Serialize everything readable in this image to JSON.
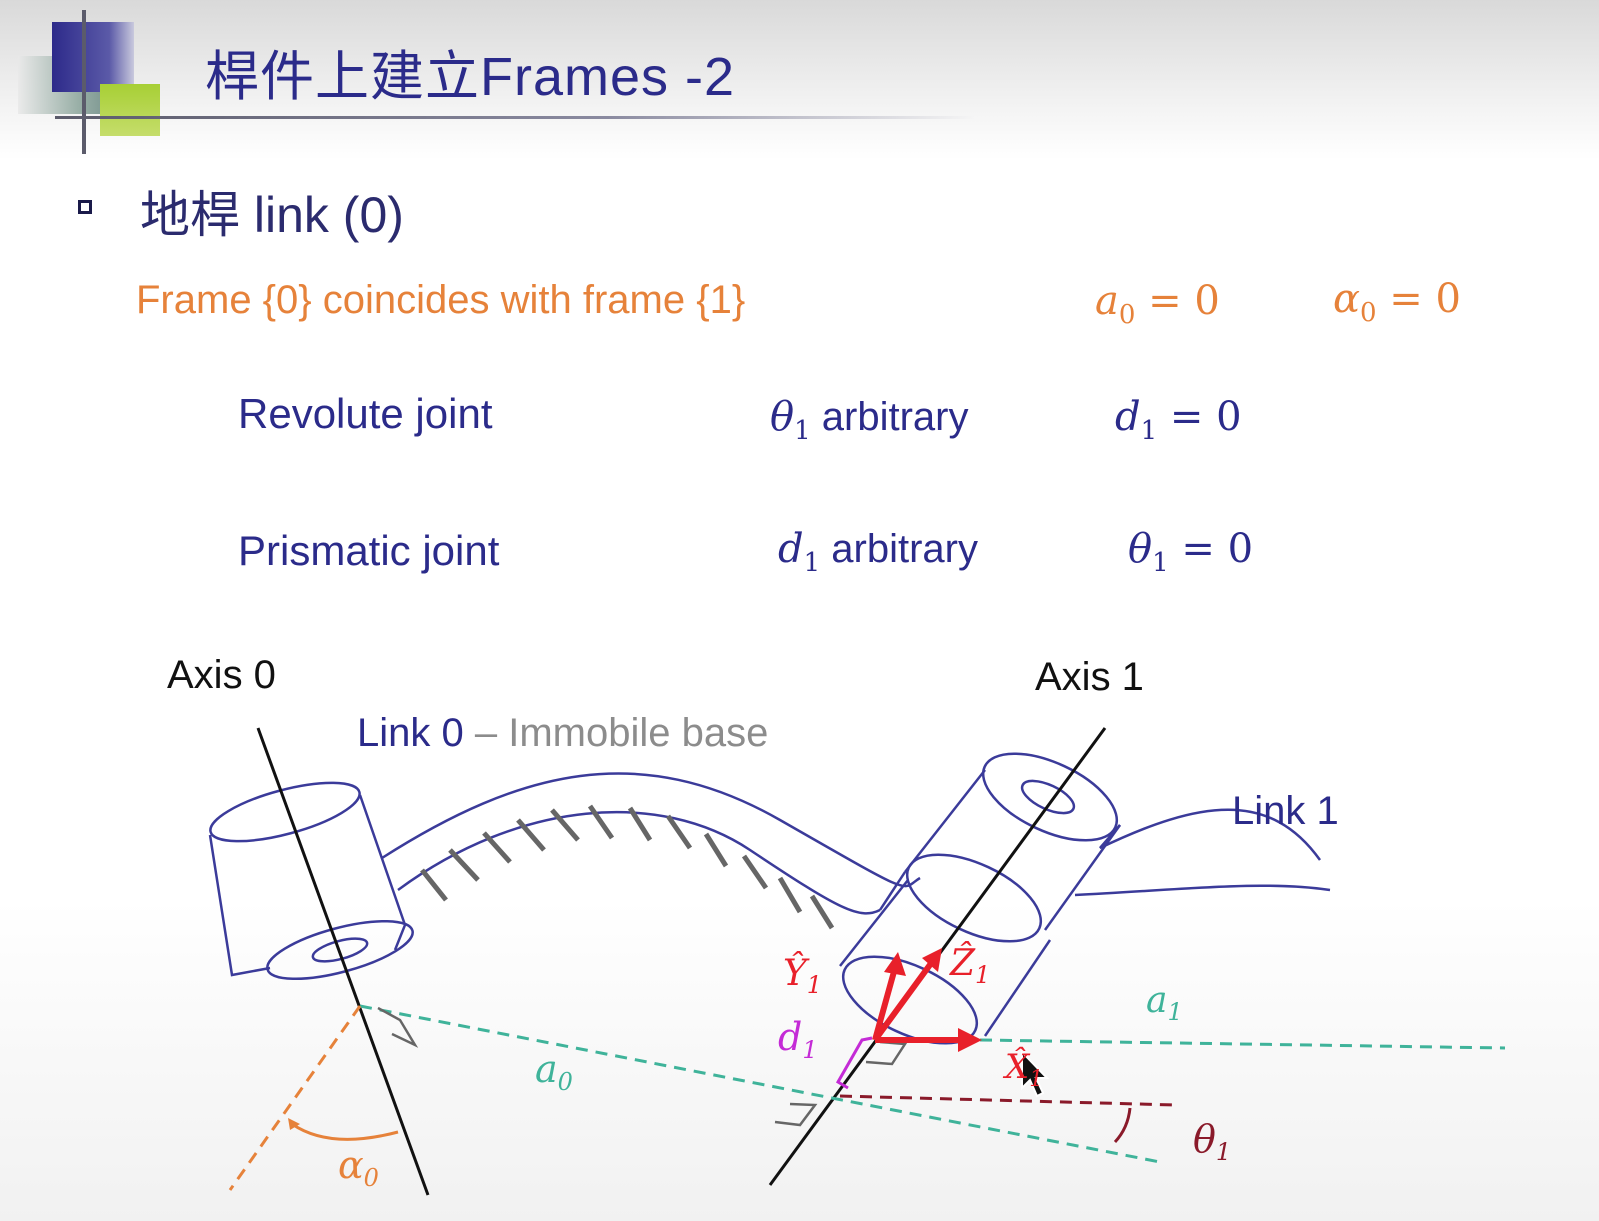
{
  "title": "桿件上建立Frames -2",
  "bullet": "地桿 link (0)",
  "frame_line": {
    "text": "Frame {0} coincides with frame {1}",
    "a0_sym": "a",
    "a0_sub": "0",
    "a0_eq": " = 0",
    "alpha0_sym": "α",
    "alpha0_sub": "0",
    "alpha0_eq": " = 0"
  },
  "rows": [
    {
      "label": "Revolute joint",
      "var_sym": "θ",
      "var_sub": "1",
      "var_text": " arbitrary",
      "cond_sym": "d",
      "cond_sub": "1",
      "cond_eq": " = 0"
    },
    {
      "label": "Prismatic joint",
      "var_sym": "d",
      "var_sub": "1",
      "var_text": " arbitrary",
      "cond_sym": "θ",
      "cond_sub": "1",
      "cond_eq": " = 0"
    }
  ],
  "diagram": {
    "axis0": "Axis 0",
    "axis1": "Axis 1",
    "link0": "Link 0",
    "link0_desc": " – Immobile base",
    "link1": "Link 1",
    "label_a0": "a",
    "label_a0_sub": "0",
    "label_alpha0": "α",
    "label_alpha0_sub": "0",
    "label_a1": "a",
    "label_a1_sub": "1",
    "label_d1": "d",
    "label_d1_sub": "1",
    "label_theta1": "θ",
    "label_theta1_sub": "1",
    "label_Y1": "Ŷ",
    "label_Y1_sub": "1",
    "label_Z1": "Ẑ",
    "label_Z1_sub": "1",
    "label_X1": "X̂",
    "label_X1_sub": "1"
  },
  "colors": {
    "navy": "#2b2b8a",
    "orange": "#e6823a",
    "teal_dashed": "#3fb39a",
    "red": "#e8202a",
    "magenta": "#c42bd6",
    "darkred": "#8a1a2a",
    "gray_text": "#8c8c8c"
  },
  "icons": {
    "bullet": "square-bullet-icon",
    "cursor": "mouse-pointer-icon"
  }
}
